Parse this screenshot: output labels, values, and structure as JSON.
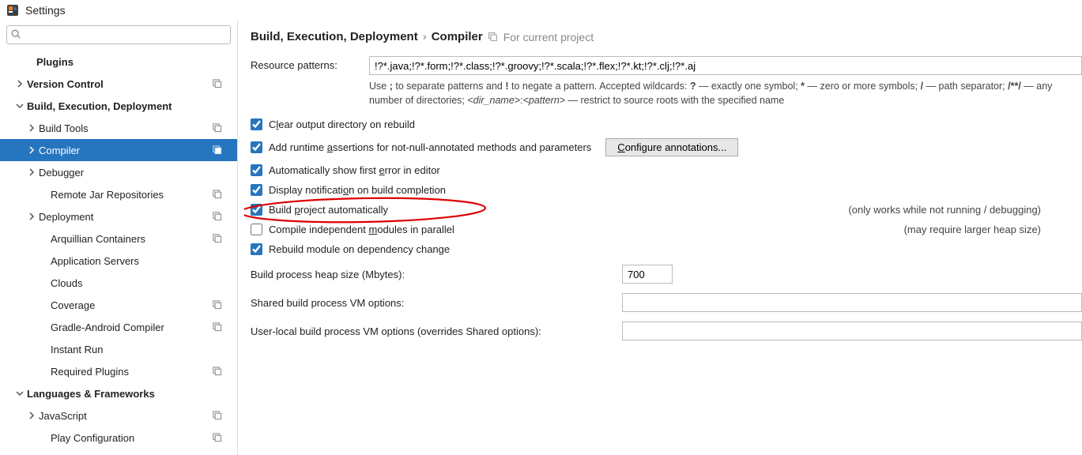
{
  "titlebar": {
    "text": "Settings"
  },
  "sidebar": {
    "search_placeholder": "",
    "items": [
      {
        "label": "Plugins",
        "indent": 30,
        "bold": true,
        "chevron": "",
        "copy": false
      },
      {
        "label": "Version Control",
        "indent": 18,
        "bold": true,
        "chevron": "right",
        "copy": true
      },
      {
        "label": "Build, Execution, Deployment",
        "indent": 18,
        "bold": true,
        "chevron": "down",
        "copy": false
      },
      {
        "label": "Build Tools",
        "indent": 33,
        "bold": false,
        "chevron": "right",
        "copy": true
      },
      {
        "label": "Compiler",
        "indent": 33,
        "bold": false,
        "chevron": "right",
        "copy": true,
        "selected": true
      },
      {
        "label": "Debugger",
        "indent": 33,
        "bold": false,
        "chevron": "right",
        "copy": false
      },
      {
        "label": "Remote Jar Repositories",
        "indent": 48,
        "bold": false,
        "chevron": "",
        "copy": true
      },
      {
        "label": "Deployment",
        "indent": 33,
        "bold": false,
        "chevron": "right",
        "copy": true
      },
      {
        "label": "Arquillian Containers",
        "indent": 48,
        "bold": false,
        "chevron": "",
        "copy": true
      },
      {
        "label": "Application Servers",
        "indent": 48,
        "bold": false,
        "chevron": "",
        "copy": false
      },
      {
        "label": "Clouds",
        "indent": 48,
        "bold": false,
        "chevron": "",
        "copy": false
      },
      {
        "label": "Coverage",
        "indent": 48,
        "bold": false,
        "chevron": "",
        "copy": true
      },
      {
        "label": "Gradle-Android Compiler",
        "indent": 48,
        "bold": false,
        "chevron": "",
        "copy": true
      },
      {
        "label": "Instant Run",
        "indent": 48,
        "bold": false,
        "chevron": "",
        "copy": false
      },
      {
        "label": "Required Plugins",
        "indent": 48,
        "bold": false,
        "chevron": "",
        "copy": true
      },
      {
        "label": "Languages & Frameworks",
        "indent": 18,
        "bold": true,
        "chevron": "down",
        "copy": false
      },
      {
        "label": "JavaScript",
        "indent": 33,
        "bold": false,
        "chevron": "right",
        "copy": true
      },
      {
        "label": "Play Configuration",
        "indent": 48,
        "bold": false,
        "chevron": "",
        "copy": true
      }
    ]
  },
  "breadcrumb": {
    "part1": "Build, Execution, Deployment",
    "sep": "›",
    "part2": "Compiler",
    "scope": "For current project"
  },
  "resource": {
    "label": "Resource patterns:",
    "value": "!?*.java;!?*.form;!?*.class;!?*.groovy;!?*.scala;!?*.flex;!?*.kt;!?*.clj;!?*.aj",
    "help_pre": "Use ",
    "help_semi": ";",
    "help_mid1": " to separate patterns and ",
    "help_bang": "!",
    "help_mid2": " to negate a pattern. Accepted wildcards: ",
    "help_q": "?",
    "help_mid3": " — exactly one symbol; ",
    "help_star": "*",
    "help_mid4": " — zero or more symbols; ",
    "help_slash": "/",
    "help_mid5": " — path separator; ",
    "help_dblstar": "/**/",
    "help_mid6": " — any number of directories; ",
    "help_dir": "<dir_name>",
    "help_colon": ":",
    "help_pat": "<pattern>",
    "help_tail": " — restrict to source roots with the specified name"
  },
  "checks": {
    "clear": {
      "label_pre": "C",
      "label_u": "l",
      "label_post": "ear output directory on rebuild",
      "checked": true
    },
    "assertions": {
      "label_pre": "Add runtime ",
      "label_u": "a",
      "label_post": "ssertions for not-null-annotated methods and parameters",
      "checked": true,
      "btn_pre": "",
      "btn_u": "C",
      "btn_post": "onfigure annotations..."
    },
    "autoerror": {
      "label_pre": "Automatically show first ",
      "label_u": "e",
      "label_post": "rror in editor",
      "checked": true
    },
    "notify": {
      "label_pre": "Display notificati",
      "label_u": "o",
      "label_post": "n on build completion",
      "checked": true
    },
    "buildauto": {
      "label_pre": "Build ",
      "label_u": "p",
      "label_post": "roject automatically",
      "checked": true,
      "hint": "(only works while not running / debugging)"
    },
    "parallel": {
      "label_pre": "Compile independent ",
      "label_u": "m",
      "label_post": "odules in parallel",
      "checked": false,
      "hint": "(may require larger heap size)"
    },
    "rebuild_dep": {
      "label_pre": "Rebuild module on dependency chan",
      "label_u": "g",
      "label_post": "e",
      "checked": true
    }
  },
  "fields": {
    "heap": {
      "label": "Build process heap size (Mbytes):",
      "value": "700"
    },
    "shared_vm": {
      "label": "Shared build process VM options:",
      "value": ""
    },
    "user_vm": {
      "label": "User-local build process VM options (overrides Shared options):",
      "value": ""
    }
  }
}
